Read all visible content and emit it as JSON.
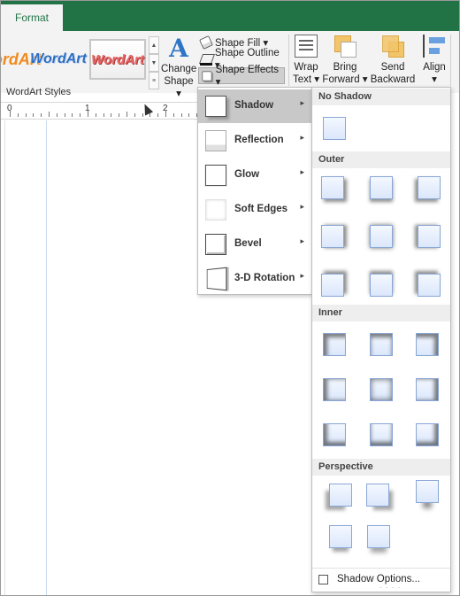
{
  "tabs": {
    "format": "Format"
  },
  "wordart": {
    "items": [
      "WordArt",
      "WordArt",
      "WordArt"
    ],
    "group_label": "WordArt Styles"
  },
  "change_shape": {
    "icon_glyph": "A",
    "line1": "Change",
    "line2": "Shape ▾"
  },
  "shape_format": {
    "fill_label": "Shape Fill ▾",
    "outline_label": "Shape Outline ▾",
    "effects_label": "Shape Effects ▾"
  },
  "arrange": {
    "wrap": {
      "line1": "Wrap",
      "line2": "Text ▾"
    },
    "bring": {
      "line1": "Bring",
      "line2": "Forward ▾"
    },
    "send": {
      "line1": "Send",
      "line2": "Backward ▾"
    },
    "align": {
      "line1": "Align",
      "line2": "▾"
    }
  },
  "ruler": {
    "labels": [
      "0",
      "1",
      "2"
    ]
  },
  "effects_menu": {
    "items": [
      {
        "label": "Shadow",
        "icon": "shadow-icon"
      },
      {
        "label": "Reflection",
        "icon": "reflection-icon"
      },
      {
        "label": "Glow",
        "icon": "glow-icon"
      },
      {
        "label": "Soft Edges",
        "icon": "soft-edges-icon"
      },
      {
        "label": "Bevel",
        "icon": "bevel-icon"
      },
      {
        "label": "3-D Rotation",
        "icon": "3d-rotation-icon"
      }
    ],
    "active_index": 0,
    "submenu_arrow": "▸"
  },
  "shadow_gallery": {
    "sections": {
      "no_shadow": "No Shadow",
      "outer": "Outer",
      "inner": "Inner",
      "perspective": "Perspective"
    },
    "options_label": "Shadow Options...",
    "grip": "· · · ·"
  },
  "colors": {
    "title_bar": "#217346",
    "ribbon_bg": "#f3f3f3",
    "accent_blue": "#2e74c7",
    "menu_active": "#c8c8c8",
    "section_bg": "#eeeeee",
    "thumb_border": "#8aa7d6"
  }
}
